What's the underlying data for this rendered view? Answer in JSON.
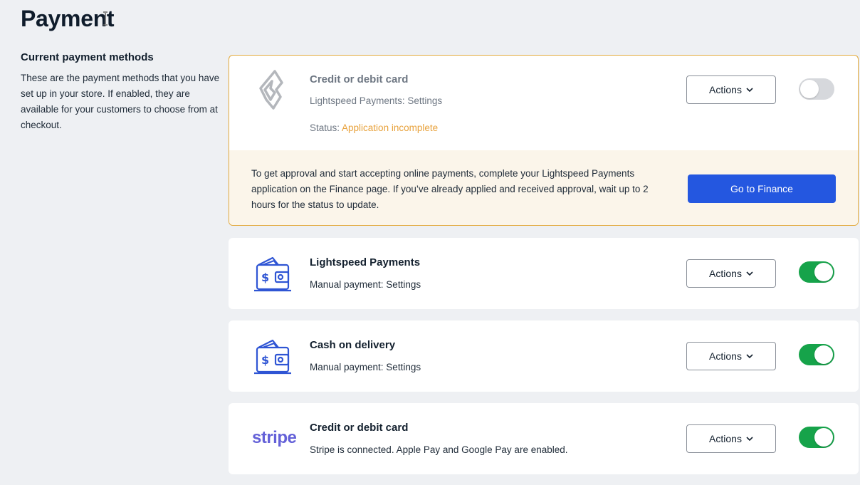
{
  "page": {
    "title": "Payment"
  },
  "side": {
    "heading": "Current payment methods",
    "description": "These are the payment methods that you have set up in your store. If enabled, they are available for your customers to choose from at checkout."
  },
  "methods": [
    {
      "title": "Credit or debit card",
      "subtitle": "Lightspeed Payments: Settings",
      "status_label": "Status: ",
      "status_value": "Application incomplete",
      "actions_label": "Actions",
      "enabled": false,
      "notice": "To get approval and start accepting online payments, complete your Lightspeed Payments application on the Finance page. If you’ve already applied and received approval, wait up to 2 hours for the status to update.",
      "notice_button": "Go to Finance",
      "icon": "lightspeed-flame-icon"
    },
    {
      "title": "Lightspeed Payments",
      "subtitle": "Manual payment: Settings",
      "actions_label": "Actions",
      "enabled": true,
      "icon": "wallet-icon"
    },
    {
      "title": "Cash on delivery",
      "subtitle": "Manual payment: Settings",
      "actions_label": "Actions",
      "enabled": true,
      "icon": "wallet-icon"
    },
    {
      "title": "Credit or debit card",
      "subtitle": "Stripe is connected. Apple Pay and Google Pay are enabled.",
      "actions_label": "Actions",
      "enabled": true,
      "logo_text": "stripe"
    }
  ],
  "colors": {
    "accent_blue": "#2457e0",
    "toggle_on": "#16a34a",
    "warning_border": "#e2a93b",
    "status_warning": "#e8a23c",
    "stripe_purple": "#6461d8",
    "icon_blue": "#2f55d4"
  }
}
